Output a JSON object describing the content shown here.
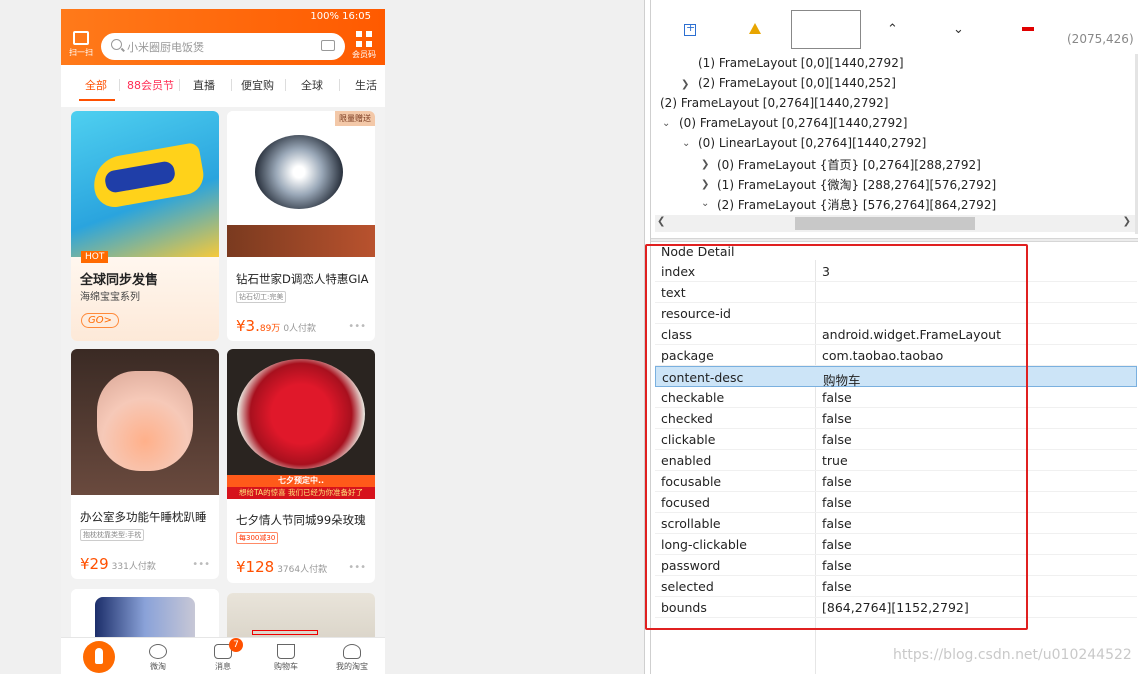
{
  "phone": {
    "status": "100% 16:05",
    "scan_label": "扫一扫",
    "search_placeholder": "小米圈厨电饭煲",
    "member_label": "会员码",
    "tabs": [
      "全部",
      "88会员节",
      "直播",
      "便宜购",
      "全球",
      "生活"
    ],
    "cards": [
      {
        "badge": "HOT",
        "headline": "全球同步发售",
        "sub": "海绵宝宝系列",
        "cta": "GO>"
      },
      {
        "corner": "限量赠送",
        "title": "钻石世家D调恋人特惠GIA",
        "tag": "钻石切工:完美",
        "price": "¥3.",
        "price_suffix": "89万",
        "paid": "0人付款"
      },
      {
        "title": "办公室多功能午睡枕趴睡",
        "tag": "抱枕枕靠类型:手枕",
        "price": "¥29",
        "paid": "331人付款"
      },
      {
        "banner1": "七夕预定中..",
        "banner2": "想给TA的惊喜 我们已经为你准备好了",
        "title": "七夕情人节同城99朵玫瑰",
        "tag": "每300减30",
        "price": "¥128",
        "paid": "3764人付款"
      }
    ],
    "nav": [
      "",
      "微淘",
      "消息",
      "购物车",
      "我的淘宝"
    ],
    "msg_badge": "7"
  },
  "toolbar": {
    "coord": "(2075,426)"
  },
  "tree": [
    "(1) FrameLayout [0,0][1440,2792]",
    "(2) FrameLayout [0,0][1440,252]",
    "(2) FrameLayout [0,2764][1440,2792]",
    "(0) FrameLayout [0,2764][1440,2792]",
    "(0) LinearLayout [0,2764][1440,2792]",
    "(0) FrameLayout {首页} [0,2764][288,2792]",
    "(1) FrameLayout {微淘} [288,2764][576,2792]",
    "(2) FrameLayout {消息} [576,2764][864,2792]"
  ],
  "detail": {
    "title": "Node Detail",
    "rows": [
      {
        "k": "index",
        "v": "3"
      },
      {
        "k": "text",
        "v": ""
      },
      {
        "k": "resource-id",
        "v": ""
      },
      {
        "k": "class",
        "v": "android.widget.FrameLayout"
      },
      {
        "k": "package",
        "v": "com.taobao.taobao"
      },
      {
        "k": "content-desc",
        "v": "购物车"
      },
      {
        "k": "checkable",
        "v": "false"
      },
      {
        "k": "checked",
        "v": "false"
      },
      {
        "k": "clickable",
        "v": "false"
      },
      {
        "k": "enabled",
        "v": "true"
      },
      {
        "k": "focusable",
        "v": "false"
      },
      {
        "k": "focused",
        "v": "false"
      },
      {
        "k": "scrollable",
        "v": "false"
      },
      {
        "k": "long-clickable",
        "v": "false"
      },
      {
        "k": "password",
        "v": "false"
      },
      {
        "k": "selected",
        "v": "false"
      },
      {
        "k": "bounds",
        "v": "[864,2764][1152,2792]"
      }
    ]
  },
  "watermark": "https://blog.csdn.net/u010244522",
  "colors": {
    "accent": "#ff5000",
    "highlight": "#e02020"
  }
}
